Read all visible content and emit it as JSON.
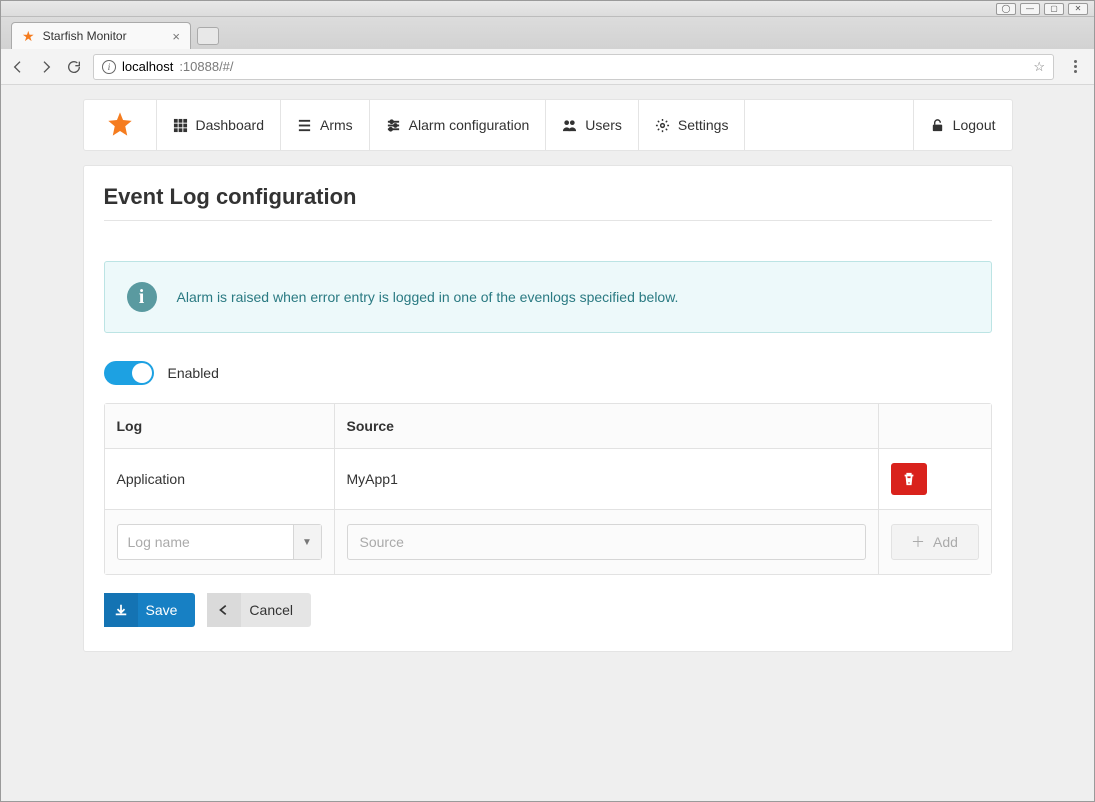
{
  "browser": {
    "tab_title": "Starfish Monitor",
    "url_host": "localhost",
    "url_rest": ":10888/#/"
  },
  "nav": {
    "dashboard": "Dashboard",
    "arms": "Arms",
    "alarm_config": "Alarm configuration",
    "users": "Users",
    "settings": "Settings",
    "logout": "Logout"
  },
  "page": {
    "title": "Event Log configuration",
    "alert": "Alarm is raised when error entry is logged in one of the evenlogs specified below.",
    "enabled_label": "Enabled",
    "headers": {
      "log": "Log",
      "source": "Source"
    },
    "row": {
      "log": "Application",
      "source": "MyApp1"
    },
    "log_placeholder": "Log name",
    "source_placeholder": "Source",
    "add_label": "Add",
    "save_label": "Save",
    "cancel_label": "Cancel"
  }
}
